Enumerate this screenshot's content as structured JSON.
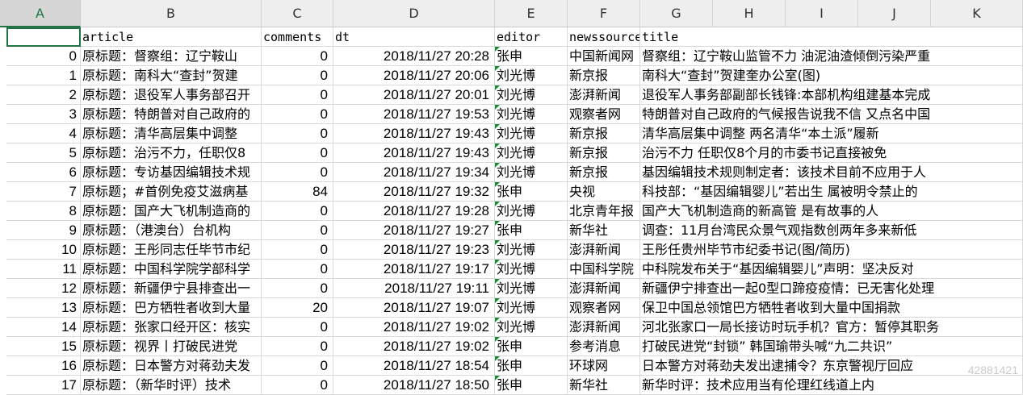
{
  "columns": [
    "A",
    "B",
    "C",
    "D",
    "E",
    "F",
    "G",
    "H",
    "I",
    "J",
    "K"
  ],
  "header_row": [
    "",
    "article",
    "comments",
    "dt",
    "editor",
    "newssource",
    "title"
  ],
  "rows": [
    {
      "idx": "0",
      "article": "原标题：督察组：辽宁鞍山",
      "comments": "0",
      "dt": "2018/11/27 20:28",
      "editor": "张申",
      "source": "中国新闻网",
      "title": "督察组：辽宁鞍山监管不力 油泥油渣倾倒污染严重"
    },
    {
      "idx": "1",
      "article": "原标题：南科大“查封”贺建",
      "comments": "0",
      "dt": "2018/11/27 20:06",
      "editor": "刘光博",
      "source": "新京报",
      "title": "南科大“查封”贺建奎办公室(图)"
    },
    {
      "idx": "2",
      "article": "原标题：退役军人事务部召开",
      "comments": "0",
      "dt": "2018/11/27 20:01",
      "editor": "刘光博",
      "source": "澎湃新闻",
      "title": "退役军人事务部副部长钱锋:本部机构组建基本完成"
    },
    {
      "idx": "3",
      "article": "原标题：特朗普对自己政府的",
      "comments": "0",
      "dt": "2018/11/27 19:53",
      "editor": "刘光博",
      "source": "观察者网",
      "title": "特朗普对自己政府的气候报告说我不信 又点名中国"
    },
    {
      "idx": "4",
      "article": "原标题：清华高层集中调整",
      "comments": "0",
      "dt": "2018/11/27 19:43",
      "editor": "刘光博",
      "source": "新京报",
      "title": "清华高层集中调整 两名清华“本土派”履新"
    },
    {
      "idx": "5",
      "article": "原标题：治污不力，任职仅8",
      "comments": "0",
      "dt": "2018/11/27 19:43",
      "editor": "刘光博",
      "source": "新京报",
      "title": "治污不力 任职仅8个月的市委书记直接被免"
    },
    {
      "idx": "6",
      "article": "原标题：专访基因编辑技术规",
      "comments": "0",
      "dt": "2018/11/27 19:34",
      "editor": "刘光博",
      "source": "新京报",
      "title": "基因编辑技术规则制定者：该技术目前不应用于人"
    },
    {
      "idx": "7",
      "article": "原标题；#首例免疫艾滋病基",
      "comments": "84",
      "dt": "2018/11/27 19:32",
      "editor": "张申",
      "source": "央视",
      "title": "科技部：“基因编辑婴儿”若出生 属被明令禁止的"
    },
    {
      "idx": "8",
      "article": "原标题：国产大飞机制造商的",
      "comments": "0",
      "dt": "2018/11/27 19:28",
      "editor": "刘光博",
      "source": "北京青年报",
      "title": "国产大飞机制造商的新高管 是有故事的人"
    },
    {
      "idx": "9",
      "article": "原标题：（港澳台）台机构",
      "comments": "0",
      "dt": "2018/11/27 19:27",
      "editor": "张申",
      "source": "新华社",
      "title": "调查：11月台湾民众景气观指数创两年多来新低"
    },
    {
      "idx": "10",
      "article": "原标题：王彤同志任毕节市纪",
      "comments": "0",
      "dt": "2018/11/27 19:23",
      "editor": "刘光博",
      "source": "澎湃新闻",
      "title": "王彤任贵州毕节市纪委书记(图/简历)"
    },
    {
      "idx": "11",
      "article": "原标题：中国科学院学部科学",
      "comments": "0",
      "dt": "2018/11/27 19:17",
      "editor": "刘光博",
      "source": "中国科学院",
      "title": "中科院发布关于“基因编辑婴儿”声明：坚决反对"
    },
    {
      "idx": "12",
      "article": "原标题：新疆伊宁县排查出一",
      "comments": "0",
      "dt": "2018/11/27 19:11",
      "editor": "刘光博",
      "source": "澎湃新闻",
      "title": "新疆伊宁排查出一起0型口蹄疫疫情：已无害化处理"
    },
    {
      "idx": "13",
      "article": "原标题：巴方牺牲者收到大量",
      "comments": "20",
      "dt": "2018/11/27 19:07",
      "editor": "刘光博",
      "source": "观察者网",
      "title": "保卫中国总领馆巴方牺牲者收到大量中国捐款"
    },
    {
      "idx": "14",
      "article": "原标题：张家口经开区：核实",
      "comments": "0",
      "dt": "2018/11/27 19:02",
      "editor": "刘光博",
      "source": "澎湃新闻",
      "title": "河北张家口一局长接访时玩手机？官方：暂停其职务"
    },
    {
      "idx": "15",
      "article": "原标题：视界丨打破民进党",
      "comments": "0",
      "dt": "2018/11/27 19:02",
      "editor": "张申",
      "source": "参考消息",
      "title": "打破民进党“封锁” 韩国瑜带头喊“九二共识”"
    },
    {
      "idx": "16",
      "article": "原标题：日本警方对蒋劲夫发",
      "comments": "0",
      "dt": "2018/11/27 18:54",
      "editor": "张申",
      "source": "环球网",
      "title": "日本警方对蒋劲夫发出逮捕令？东京警视厅回应"
    },
    {
      "idx": "17",
      "article": "原标题：（新华时评）技术",
      "comments": "0",
      "dt": "2018/11/27 18:50",
      "editor": "张申",
      "source": "新华社",
      "title": "新华时评：技术应用当有伦理红线道上内"
    }
  ],
  "watermark": "42881421",
  "colors": {
    "accent": "#217346",
    "flag": "#1e8a3c"
  }
}
